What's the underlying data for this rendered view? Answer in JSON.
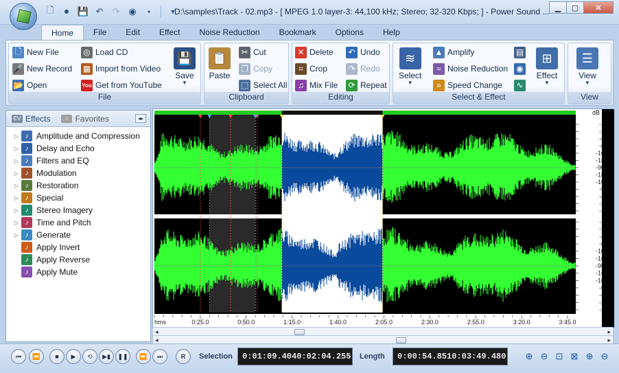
{
  "title": "D:\\samples\\Track - 02.mp3 - [ MPEG 1.0 layer-3: 44,100 kHz; Stereo; 32-320 Kbps;  ] - Power Sound ...",
  "quick_access": [
    "new-icon",
    "record-icon",
    "save-icon",
    "undo-icon",
    "redo-icon",
    "cd-icon",
    "dropdown-icon"
  ],
  "menu_tabs": [
    "Home",
    "File",
    "Edit",
    "Effect",
    "Noise Reduction",
    "Bookmark",
    "Options",
    "Help"
  ],
  "active_tab": "Home",
  "ribbon": {
    "file": {
      "label": "File",
      "new_file": "New File",
      "new_record": "New Record",
      "open": "Open",
      "load_cd": "Load CD",
      "import_video": "Import from Video",
      "get_youtube": "Get from YouTube",
      "save": "Save"
    },
    "clipboard": {
      "label": "Clipboard",
      "paste": "Paste",
      "cut": "Cut",
      "copy": "Copy",
      "select_all": "Select All"
    },
    "editing": {
      "label": "Editing",
      "delete": "Delete",
      "crop": "Crop",
      "mix_file": "Mix File",
      "undo": "Undo",
      "redo": "Redo",
      "repeat": "Repeat"
    },
    "select_effect": {
      "label": "Select & Effect",
      "select": "Select",
      "amplify": "Amplify",
      "noise_reduction": "Noise Reduction",
      "speed_change": "Speed Change",
      "effect": "Effect"
    },
    "view": {
      "label": "View",
      "view": "View"
    }
  },
  "left_panel": {
    "tabs": [
      "Effects",
      "Favorites"
    ],
    "effects": [
      {
        "label": "Amplitude and Compression",
        "expandable": true,
        "icon": "amplitude-icon"
      },
      {
        "label": "Delay and Echo",
        "expandable": true,
        "icon": "echo-icon"
      },
      {
        "label": "Filters and EQ",
        "expandable": true,
        "icon": "filter-icon"
      },
      {
        "label": "Modulation",
        "expandable": true,
        "icon": "modulation-icon"
      },
      {
        "label": "Restoration",
        "expandable": true,
        "icon": "restoration-icon"
      },
      {
        "label": "Special",
        "expandable": true,
        "icon": "special-icon"
      },
      {
        "label": "Stereo Imagery",
        "expandable": true,
        "icon": "stereo-icon"
      },
      {
        "label": "Time and Pitch",
        "expandable": true,
        "icon": "time-pitch-icon"
      },
      {
        "label": "Generate",
        "expandable": true,
        "icon": "generate-icon"
      },
      {
        "label": "Apply Invert",
        "expandable": false,
        "icon": "invert-icon"
      },
      {
        "label": "Apply Reverse",
        "expandable": false,
        "icon": "reverse-icon"
      },
      {
        "label": "Apply Mute",
        "expandable": false,
        "icon": "mute-icon"
      }
    ]
  },
  "waveform": {
    "db_unit": "dB",
    "db_ticks": [
      "-1",
      "-2",
      "-4",
      "-6",
      "-10",
      "-16",
      "-90",
      "-16",
      "-10",
      "-6",
      "-4",
      "-2",
      "-1"
    ],
    "time_unit": "hms",
    "time_ticks": [
      "0:25.0",
      "0:50.0",
      "1:15.0",
      "1:40.0",
      "2:05.0",
      "2:30.0",
      "2:55.0",
      "3:20.0",
      "3:45.0"
    ],
    "total_seconds": 229.48,
    "selection_seconds": [
      69.404,
      124.255
    ],
    "dark_region_seconds": [
      30.0,
      55.0
    ],
    "colors": {
      "wave": "#33ff33",
      "selected_wave": "#0a4a9c",
      "selected_bg": "#ffffff",
      "bg": "#000000",
      "marker": "#ff4444"
    }
  },
  "transport": {
    "buttons": [
      "go-start",
      "rewind",
      "stop",
      "play",
      "loop",
      "play-selection",
      "pause",
      "fast-forward",
      "go-end",
      "record"
    ],
    "selection_label": "Selection",
    "selection_start": "0:01:09.404",
    "selection_end": "0:02:04.255",
    "length_label": "Length",
    "length_selection": "0:00:54.851",
    "length_total": "0:03:49.480"
  }
}
